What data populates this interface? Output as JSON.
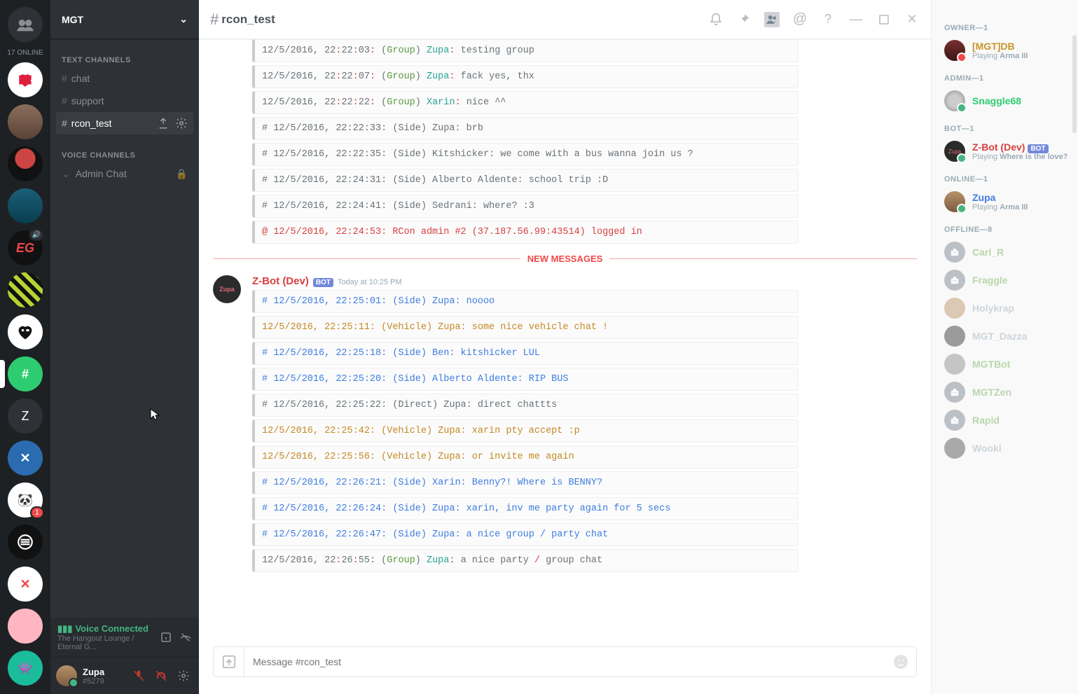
{
  "guilds": {
    "online_count": "17 ONLINE",
    "active_letter": "Z"
  },
  "server": {
    "name": "MGT",
    "categories": {
      "text": "TEXT CHANNELS",
      "voice": "VOICE CHANNELS"
    },
    "text_channels": [
      "chat",
      "support",
      "rcon_test"
    ],
    "voice_channels": [
      "Admin Chat"
    ]
  },
  "voice": {
    "title": "Voice Connected",
    "sub": "The Hangout Lounge / Eternal G..."
  },
  "user": {
    "name": "Zupa",
    "tag": "#5279"
  },
  "titlebar": {
    "hash": "#",
    "name": "rcon_test"
  },
  "divider": "NEW MESSAGES",
  "group2": {
    "author": "Z-Bot (Dev)",
    "bot": "BOT",
    "time": "Today at 10:25 PM"
  },
  "input": {
    "placeholder": "Message #rcon_test"
  },
  "lines1": [
    {
      "style": "group",
      "parts": [
        {
          "c": "grey",
          "t": "12/5/2016, 22"
        },
        {
          "c": "red",
          "t": ":"
        },
        {
          "c": "grey",
          "t": "22"
        },
        {
          "c": "red",
          "t": ":"
        },
        {
          "c": "grey",
          "t": "03"
        },
        {
          "c": "red",
          "t": ": "
        },
        {
          "c": "grey",
          "t": "("
        },
        {
          "c": "green",
          "t": "Group"
        },
        {
          "c": "grey",
          "t": ") "
        },
        {
          "c": "teal",
          "t": "Zupa"
        },
        {
          "c": "red",
          "t": ": "
        },
        {
          "c": "grey",
          "t": "testing group"
        }
      ]
    },
    {
      "style": "group",
      "parts": [
        {
          "c": "grey",
          "t": "12/5/2016, 22"
        },
        {
          "c": "red",
          "t": ":"
        },
        {
          "c": "grey",
          "t": "22"
        },
        {
          "c": "red",
          "t": ":"
        },
        {
          "c": "grey",
          "t": "07"
        },
        {
          "c": "red",
          "t": ": "
        },
        {
          "c": "grey",
          "t": "("
        },
        {
          "c": "green",
          "t": "Group"
        },
        {
          "c": "grey",
          "t": ") "
        },
        {
          "c": "teal",
          "t": "Zupa"
        },
        {
          "c": "red",
          "t": ": "
        },
        {
          "c": "grey",
          "t": "fack yes, thx"
        }
      ]
    },
    {
      "style": "group",
      "parts": [
        {
          "c": "grey",
          "t": "12/5/2016, 22"
        },
        {
          "c": "red",
          "t": ":"
        },
        {
          "c": "grey",
          "t": "22"
        },
        {
          "c": "red",
          "t": ":"
        },
        {
          "c": "grey",
          "t": "22"
        },
        {
          "c": "red",
          "t": ": "
        },
        {
          "c": "grey",
          "t": "("
        },
        {
          "c": "green",
          "t": "Group"
        },
        {
          "c": "grey",
          "t": ") "
        },
        {
          "c": "teal",
          "t": "Xarin"
        },
        {
          "c": "red",
          "t": ": "
        },
        {
          "c": "grey",
          "t": "nice ^^"
        }
      ]
    },
    {
      "style": "plain",
      "parts": [
        {
          "c": "grey",
          "t": "# 12/5/2016, 22:22:33: (Side) Zupa: brb"
        }
      ]
    },
    {
      "style": "plain",
      "parts": [
        {
          "c": "grey",
          "t": "# 12/5/2016, 22:22:35: (Side) Kitshicker: we come with a bus wanna join us ?"
        }
      ]
    },
    {
      "style": "plain",
      "parts": [
        {
          "c": "grey",
          "t": "# 12/5/2016, 22:24:31: (Side) Alberto Aldente: school trip :D"
        }
      ]
    },
    {
      "style": "plain",
      "parts": [
        {
          "c": "grey",
          "t": "# 12/5/2016, 22:24:41: (Side) Sedrani: where? :3"
        }
      ]
    },
    {
      "style": "rcon",
      "parts": [
        {
          "c": "red",
          "t": "@ 12/5/2016, 22:24:53: RCon admin #2 (37.187.56.99:43514) logged in"
        }
      ]
    }
  ],
  "lines2": [
    {
      "style": "side",
      "parts": [
        {
          "c": "blue",
          "t": "# 12/5/2016, 22:25:01: (Side) Zupa: noooo"
        }
      ]
    },
    {
      "style": "vehicle",
      "parts": [
        {
          "c": "orange",
          "t": "12/5/2016, 22:25:11: (Vehicle) Zupa: some nice vehicle chat !"
        }
      ]
    },
    {
      "style": "side",
      "parts": [
        {
          "c": "blue",
          "t": "# 12/5/2016, 22:25:18: (Side) Ben: kitshicker LUL"
        }
      ]
    },
    {
      "style": "side",
      "parts": [
        {
          "c": "blue",
          "t": "# 12/5/2016, 22:25:20: (Side) Alberto Aldente: RIP BUS"
        }
      ]
    },
    {
      "style": "plain",
      "parts": [
        {
          "c": "grey",
          "t": "# 12/5/2016, 22:25:22: (Direct) Zupa: direct chattts"
        }
      ]
    },
    {
      "style": "vehicle",
      "parts": [
        {
          "c": "orange",
          "t": "12/5/2016, 22:25:42: (Vehicle) Zupa: xarin pty accept :p"
        }
      ]
    },
    {
      "style": "vehicle",
      "parts": [
        {
          "c": "orange",
          "t": "12/5/2016, 22:25:56: (Vehicle) Zupa: or invite me again"
        }
      ]
    },
    {
      "style": "side",
      "parts": [
        {
          "c": "blue",
          "t": "# 12/5/2016, 22:26:21: (Side) Xarin: Benny?! Where is BENNY?"
        }
      ]
    },
    {
      "style": "side",
      "parts": [
        {
          "c": "blue",
          "t": "# 12/5/2016, 22:26:24: (Side) Zupa: xarin, inv me party again for 5 secs"
        }
      ]
    },
    {
      "style": "side",
      "parts": [
        {
          "c": "blue",
          "t": "# 12/5/2016, 22:26:47: (Side) Zupa: a nice group / party chat"
        }
      ]
    },
    {
      "style": "group",
      "parts": [
        {
          "c": "grey",
          "t": "12/5/2016, 22"
        },
        {
          "c": "red",
          "t": ":"
        },
        {
          "c": "grey",
          "t": "26"
        },
        {
          "c": "red",
          "t": ":"
        },
        {
          "c": "grey",
          "t": "55"
        },
        {
          "c": "red",
          "t": ": "
        },
        {
          "c": "grey",
          "t": "("
        },
        {
          "c": "green",
          "t": "Group"
        },
        {
          "c": "grey",
          "t": ") "
        },
        {
          "c": "teal",
          "t": "Zupa"
        },
        {
          "c": "red",
          "t": ": "
        },
        {
          "c": "grey",
          "t": "a nice party "
        },
        {
          "c": "red",
          "t": "/ "
        },
        {
          "c": "grey",
          "t": "group chat"
        }
      ]
    }
  ],
  "members": {
    "owner_label": "OWNER—1",
    "owner": {
      "name": "[MGT]DB",
      "game_prefix": "Playing ",
      "game": "Arma III"
    },
    "admin_label": "ADMIN—1",
    "admin": {
      "name": "Snaggle68"
    },
    "bot_label": "BOT—1",
    "bot": {
      "name": "Z-Bot (Dev)",
      "badge": "BOT",
      "game_prefix": "Playing ",
      "game": "Where is the love?"
    },
    "online_label": "ONLINE—1",
    "online": {
      "name": "Zupa",
      "game_prefix": "Playing ",
      "game": "Arma III"
    },
    "offline_label": "OFFLINE—8",
    "offline": [
      "Carl_R",
      "Fraggle",
      "Holykrap",
      "MGT_Dazza",
      "MGTBot",
      "MGTZen",
      "Rapid",
      "Wooki"
    ]
  }
}
